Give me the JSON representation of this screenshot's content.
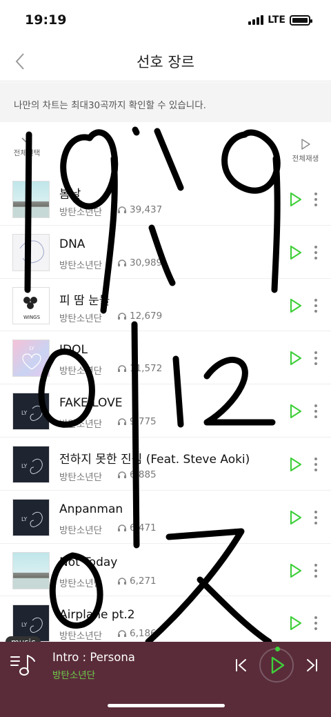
{
  "status_bar": {
    "time": "19:19",
    "network": "LTE"
  },
  "header": {
    "title": "선호 장르"
  },
  "notice": {
    "text": "나만의 차트는 최대30곡까지 확인할 수 있습니다."
  },
  "toolbar": {
    "select_all_label": "전체선택",
    "play_all_label": "전체재생"
  },
  "songs": [
    {
      "title": "봄날",
      "artist": "방탄소년단",
      "plays": "39,437",
      "art": "spring-day"
    },
    {
      "title": "DNA",
      "artist": "방탄소년단",
      "plays": "30,989",
      "art": "her"
    },
    {
      "title": "피 땀 눈물",
      "artist": "방탄소년단",
      "plays": "12,679",
      "art": "wings"
    },
    {
      "title": "IDOL",
      "artist": "방탄소년단",
      "plays": "11,572",
      "art": "answer"
    },
    {
      "title": "FAKE LOVE",
      "artist": "방탄소년단",
      "plays": "9,775",
      "art": "tear"
    },
    {
      "title": "전하지 못한 진심 (Feat. Steve Aoki)",
      "artist": "방탄소년단",
      "plays": "6,885",
      "art": "tear"
    },
    {
      "title": "Anpanman",
      "artist": "방탄소년단",
      "plays": "6,471",
      "art": "tear"
    },
    {
      "title": "Not Today",
      "artist": "방탄소년단",
      "plays": "6,271",
      "art": "spring-day"
    },
    {
      "title": "Airplane pt.2",
      "artist": "방탄소년단",
      "plays": "6,186",
      "art": "tear"
    }
  ],
  "album_art_text": {
    "wings": "WINGS",
    "love_yourself": "LY"
  },
  "mini_player": {
    "badge": "music",
    "title": "Intro : Persona",
    "artist": "방탄소년단"
  },
  "colors": {
    "accent_green": "#3fcf3a",
    "player_bg": "#5a2c3a",
    "player_artist": "#6fd04a"
  },
  "overlay": {
    "handwriting": "19.19\n9.12\n0ス"
  }
}
